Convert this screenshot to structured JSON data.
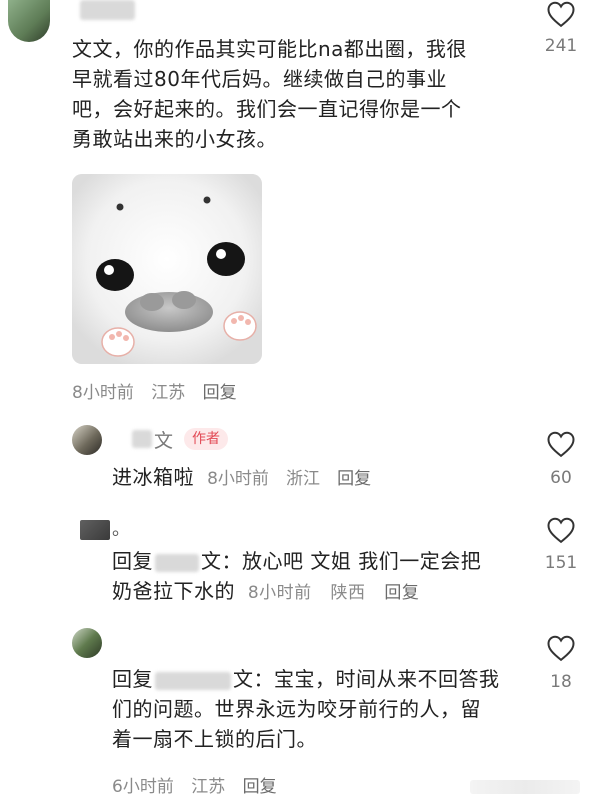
{
  "comments": [
    {
      "text": "文文，你的作品其实可能比na都出圈，我很早就看过80年代后妈。继续做自己的事业吧，会好起来的。我们会一直记得你是一个勇敢站出来的小女孩。",
      "lines": [
        "文文，你的作品其实可能比na都出圈，我很",
        "早就看过80年代后妈。继续做自己的事业",
        "吧，会好起来的。我们会一直记得你是一个",
        "勇敢站出来的小女孩。"
      ],
      "likes": "241",
      "time": "8小时前",
      "location": "江苏",
      "reply": "回复"
    }
  ],
  "replies": [
    {
      "name_visible": "文",
      "badge": "作者",
      "text": "进冰箱啦",
      "time": "8小时前",
      "location": "浙江",
      "reply": "回复",
      "likes": "60"
    },
    {
      "name_visible": "。",
      "prefix": "回复",
      "target_suffix": "文：",
      "lines": [
        "放心吧 文姐 我们一定会把",
        "奶爸拉下水的"
      ],
      "time": "8小时前",
      "location": "陕西",
      "reply": "回复",
      "likes": "151"
    },
    {
      "prefix": "回复",
      "target_suffix": "文：",
      "lines": [
        "宝宝，时间从来不回答我",
        "们的问题。世界永远为咬牙前行的人，留",
        "着一扇不上锁的后门。"
      ],
      "time": "6小时前",
      "location": "江苏",
      "reply": "回复",
      "likes": "18"
    }
  ],
  "icons": {
    "heart": "heart-outline-icon",
    "photo": "seal-pup-image"
  },
  "colors": {
    "badge_bg": "#fde9ea",
    "badge_text": "#e24a55",
    "meta": "#8a8a8a"
  }
}
